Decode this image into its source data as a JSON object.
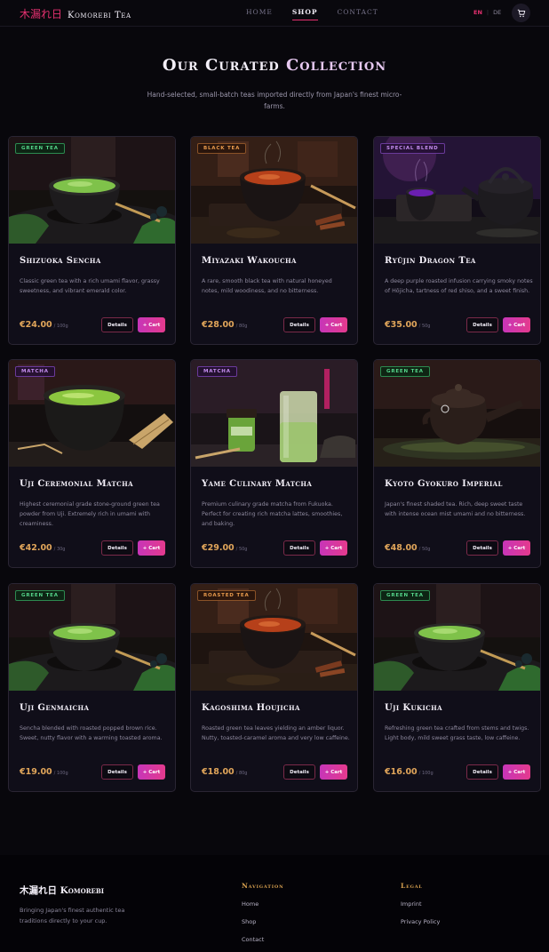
{
  "header": {
    "brand_kanji": "木漏れ日",
    "brand_name": "Komorebi Tea",
    "nav": [
      "HOME",
      "SHOP",
      "CONTACT"
    ],
    "active_nav": "SHOP",
    "lang_en": "EN",
    "lang_sep": "|",
    "lang_de": "DE",
    "cart_icon": "cart-icon"
  },
  "hero": {
    "title_main": "Our Curated ",
    "title_accent": "Collection",
    "subtitle": "Hand-selected, small-batch teas imported directly from Japan's finest micro-farms."
  },
  "products": [
    {
      "badge": "GREEN TEA",
      "badge_style": "green",
      "scene": "green",
      "name": "Shizuoka Sencha",
      "desc": "Classic green tea with a rich umami flavor, grassy sweetness, and vibrant emerald color.",
      "price": "€24.00",
      "unit": "/ 100g",
      "details": "Details",
      "cart": "+ Cart"
    },
    {
      "badge": "BLACK TEA",
      "badge_style": "black",
      "scene": "black",
      "name": "Miyazaki Wakoucha",
      "desc": "A rare, smooth black tea with natural honeyed notes, mild woodiness, and no bitterness.",
      "price": "€28.00",
      "unit": "/ 80g",
      "details": "Details",
      "cart": "+ Cart"
    },
    {
      "badge": "SPECIAL BLEND",
      "badge_style": "purple",
      "scene": "purple",
      "name": "Ryūjin Dragon Tea",
      "desc": "A deep purple roasted infusion carrying smoky notes of Hōjicha, tartness of red shiso, and a sweet finish.",
      "price": "€35.00",
      "unit": "/ 50g",
      "details": "Details",
      "cart": "+ Cart"
    },
    {
      "badge": "MATCHA",
      "badge_style": "purple",
      "scene": "matcha",
      "name": "Uji Ceremonial Matcha",
      "desc": "Highest ceremonial grade stone-ground green tea powder from Uji. Extremely rich in umami with creaminess.",
      "price": "€42.00",
      "unit": "/ 30g",
      "details": "Details",
      "cart": "+ Cart"
    },
    {
      "badge": "MATCHA",
      "badge_style": "purple",
      "scene": "latte",
      "name": "Yame Culinary Matcha",
      "desc": "Premium culinary grade matcha from Fukuoka. Perfect for creating rich matcha lattes, smoothies, and baking.",
      "price": "€29.00",
      "unit": "/ 50g",
      "details": "Details",
      "cart": "+ Cart"
    },
    {
      "badge": "GREEN TEA",
      "badge_style": "green",
      "scene": "teapot",
      "name": "Kyoto Gyokuro Imperial",
      "desc": "Japan's finest shaded tea. Rich, deep sweet taste with intense ocean mist umami and no bitterness.",
      "price": "€48.00",
      "unit": "/ 50g",
      "details": "Details",
      "cart": "+ Cart"
    },
    {
      "badge": "GREEN TEA",
      "badge_style": "green",
      "scene": "green",
      "name": "Uji Genmaicha",
      "desc": "Sencha blended with roasted popped brown rice. Sweet, nutty flavor with a warming toasted aroma.",
      "price": "€19.00",
      "unit": "/ 100g",
      "details": "Details",
      "cart": "+ Cart"
    },
    {
      "badge": "ROASTED TEA",
      "badge_style": "black",
      "scene": "black",
      "name": "Kagoshima Houjicha",
      "desc": "Roasted green tea leaves yielding an amber liquor. Nutty, toasted-caramel aroma and very low caffeine.",
      "price": "€18.00",
      "unit": "/ 80g",
      "details": "Details",
      "cart": "+ Cart"
    },
    {
      "badge": "GREEN TEA",
      "badge_style": "green",
      "scene": "green",
      "name": "Uji Kukicha",
      "desc": "Refreshing green tea crafted from stems and twigs. Light body, mild sweet grass taste, low caffeine.",
      "price": "€16.00",
      "unit": "/ 100g",
      "details": "Details",
      "cart": "+ Cart"
    }
  ],
  "footer": {
    "brand": "木漏れ日 Komorebi",
    "tagline": "Bringing Japan's finest authentic tea traditions directly to your cup.",
    "nav_heading": "Navigation",
    "nav_links": [
      "Home",
      "Shop",
      "Contact"
    ],
    "legal_heading": "Legal",
    "legal_links": [
      "Imprint",
      "Privacy Policy"
    ]
  }
}
